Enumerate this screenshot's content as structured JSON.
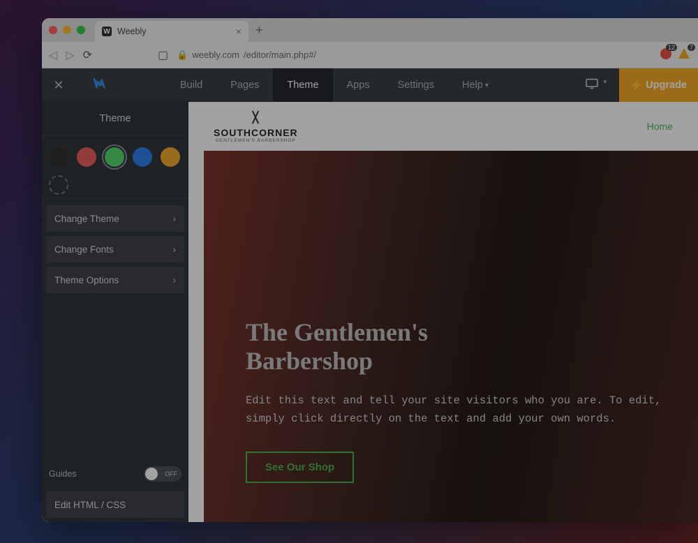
{
  "browser": {
    "tab_title": "Weebly",
    "url_host": "weebly.com",
    "url_path": "/editor/main.php#/",
    "ext_badges": [
      {
        "count": "12",
        "color": "#e74c3c"
      },
      {
        "count": "7",
        "color": "#f5a623"
      }
    ]
  },
  "nav": {
    "items": [
      "Build",
      "Pages",
      "Theme",
      "Apps",
      "Settings",
      "Help"
    ],
    "active_index": 2,
    "upgrade_label": "Upgrade"
  },
  "panel": {
    "title": "Theme",
    "swatches": [
      {
        "color": "#2a2a2a",
        "selected": false
      },
      {
        "color": "#e85a5a",
        "selected": false
      },
      {
        "color": "#4cd964",
        "selected": true
      },
      {
        "color": "#2a7bea",
        "selected": false
      },
      {
        "color": "#f0a726",
        "selected": false
      },
      {
        "color": "dashed",
        "selected": false
      }
    ],
    "menu": [
      {
        "label": "Change Theme"
      },
      {
        "label": "Change Fonts"
      },
      {
        "label": "Theme Options"
      }
    ],
    "guides_label": "Guides",
    "guides_state": "OFF",
    "edit_css_label": "Edit HTML / CSS"
  },
  "site": {
    "brand_line1": "SOUTHCORNER",
    "brand_line2": "GENTLEMEN'S BARBERSHOP",
    "nav_home": "Home",
    "hero_title_line1": "The Gentlemen's",
    "hero_title_line2": "Barbershop",
    "hero_body": "Edit this text and tell your site visitors who you are. To edit, simply click directly on the text and add your own words.",
    "cta_label": "See Our Shop"
  }
}
